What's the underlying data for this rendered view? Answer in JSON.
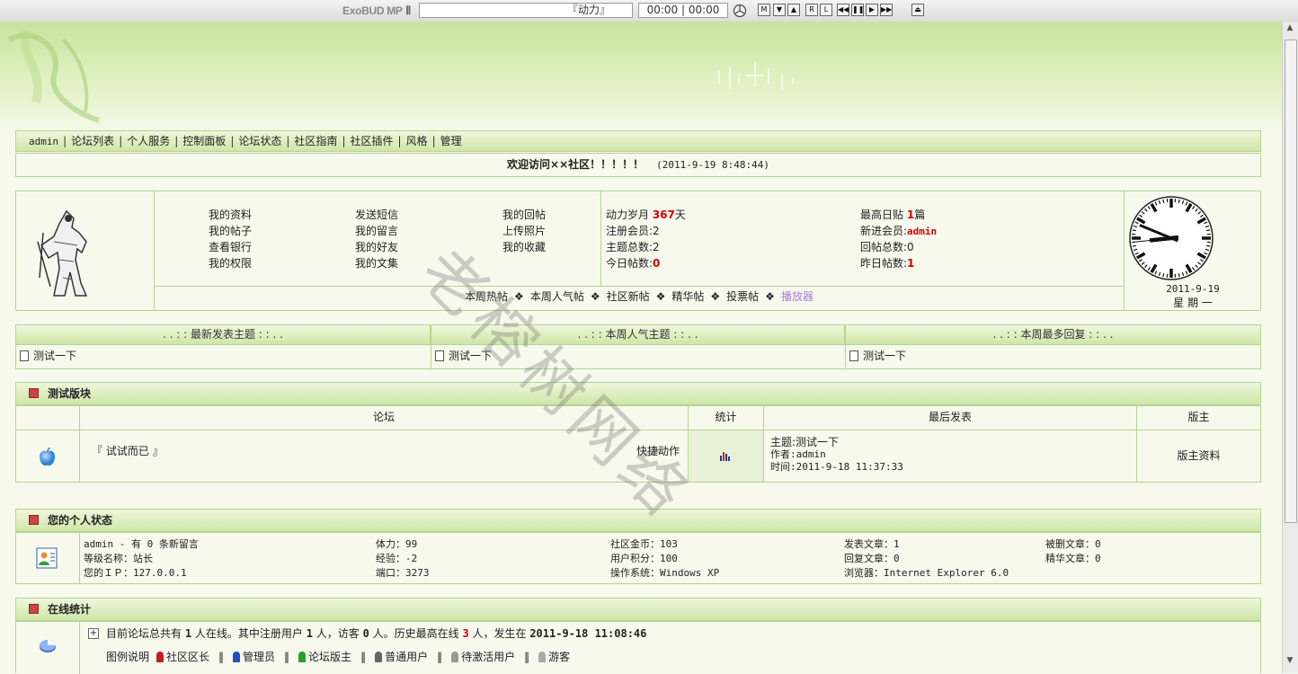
{
  "player": {
    "brand": "ExoBUD MP",
    "track": "『动力』",
    "time": "00:00 | 00:00",
    "controls": [
      "M",
      "▼",
      "▲",
      "R",
      "L",
      "◀◀",
      "❚❚",
      "▶",
      "▶▶",
      "⏏"
    ]
  },
  "nav": {
    "items": [
      "admin",
      "论坛列表",
      "个人服务",
      "控制面板",
      "论坛状态",
      "社区指南",
      "社区插件",
      "风格",
      "管理"
    ]
  },
  "welcome": {
    "text": "欢迎访问××社区！！！！！",
    "time": "(2011-9-19 8:48:44)"
  },
  "user_panel": {
    "links_col1": [
      "我的资料",
      "我的帖子",
      "查看银行",
      "我的权限"
    ],
    "links_col2": [
      "发送短信",
      "我的留言",
      "我的好友",
      "我的文集"
    ],
    "links_col3": [
      "我的回帖",
      "上传照片",
      "我的收藏"
    ],
    "stats_left": [
      {
        "label": "动力岁月 ",
        "value": "367",
        "suffix": "天"
      },
      {
        "label": "注册会员:",
        "value": "2",
        "suffix": ""
      },
      {
        "label": "主题总数:",
        "value": "2",
        "suffix": ""
      },
      {
        "label": "今日帖数:",
        "value": "0",
        "suffix": ""
      }
    ],
    "stats_right": [
      {
        "label": "最高日贴 ",
        "value": "1",
        "suffix": "篇"
      },
      {
        "label": "新进会员:",
        "value": "admin",
        "suffix": ""
      },
      {
        "label": "回帖总数:",
        "value": "0",
        "suffix": ""
      },
      {
        "label": "昨日帖数:",
        "value": "1",
        "suffix": ""
      }
    ],
    "quick_links": [
      "本周热帖",
      "本周人气帖",
      "社区新帖",
      "精华帖",
      "投票帖",
      "播放器"
    ],
    "clock_date": "2011-9-19",
    "clock_weekday": "星 期 一",
    "clock_time": {
      "hour": 8,
      "minute": 48,
      "second": 44
    }
  },
  "latest": {
    "headers": [
      ". . : : 最新发表主题 : : . .",
      ". . : : 本周人气主题 : : . .",
      ". . : : 本周最多回复 : : . ."
    ],
    "items": [
      "测试一下",
      "测试一下",
      "测试一下"
    ]
  },
  "forum_section": {
    "title": "测试版块",
    "columns": [
      "论坛",
      "统计",
      "最后发表",
      "版主"
    ],
    "row": {
      "name": "『 试试而已 』",
      "quick_action": "快捷动作",
      "last_topic": "主题:测试一下",
      "last_author": "作者:admin",
      "last_time": "时间:2011-9-18 11:37:33",
      "moderator": "版主资料"
    }
  },
  "personal_status": {
    "title": "您的个人状态",
    "col1": [
      "admin - 有 0 条新留言",
      "等级名称：站长",
      "您的ＩＰ：127.0.0.1"
    ],
    "col2": [
      "体力：99",
      "经验：-2",
      "端口：3273"
    ],
    "col3": [
      "社区金币：103",
      "用户积分：100",
      "操作系统：Windows XP"
    ],
    "col4": [
      "发表文章：1",
      "回复文章：0",
      "浏览器：Internet Explorer 6.0"
    ],
    "col5": [
      "被删文章：0",
      "精华文章：0"
    ]
  },
  "online": {
    "title": "在线统计",
    "summary_parts": [
      "目前论坛总共有 ",
      "1",
      " 人在线。其中注册用户 ",
      "1",
      " 人，访客 ",
      "0",
      " 人。历史最高在线 ",
      "3",
      " 人，发生在 ",
      "2011-9-18 11:08:46"
    ],
    "legend_label": "图例说明",
    "legend": [
      "社区区长",
      "管理员",
      "论坛版主",
      "普通用户",
      "待激活用户",
      "游客"
    ]
  },
  "watermark": "老榕树网络"
}
